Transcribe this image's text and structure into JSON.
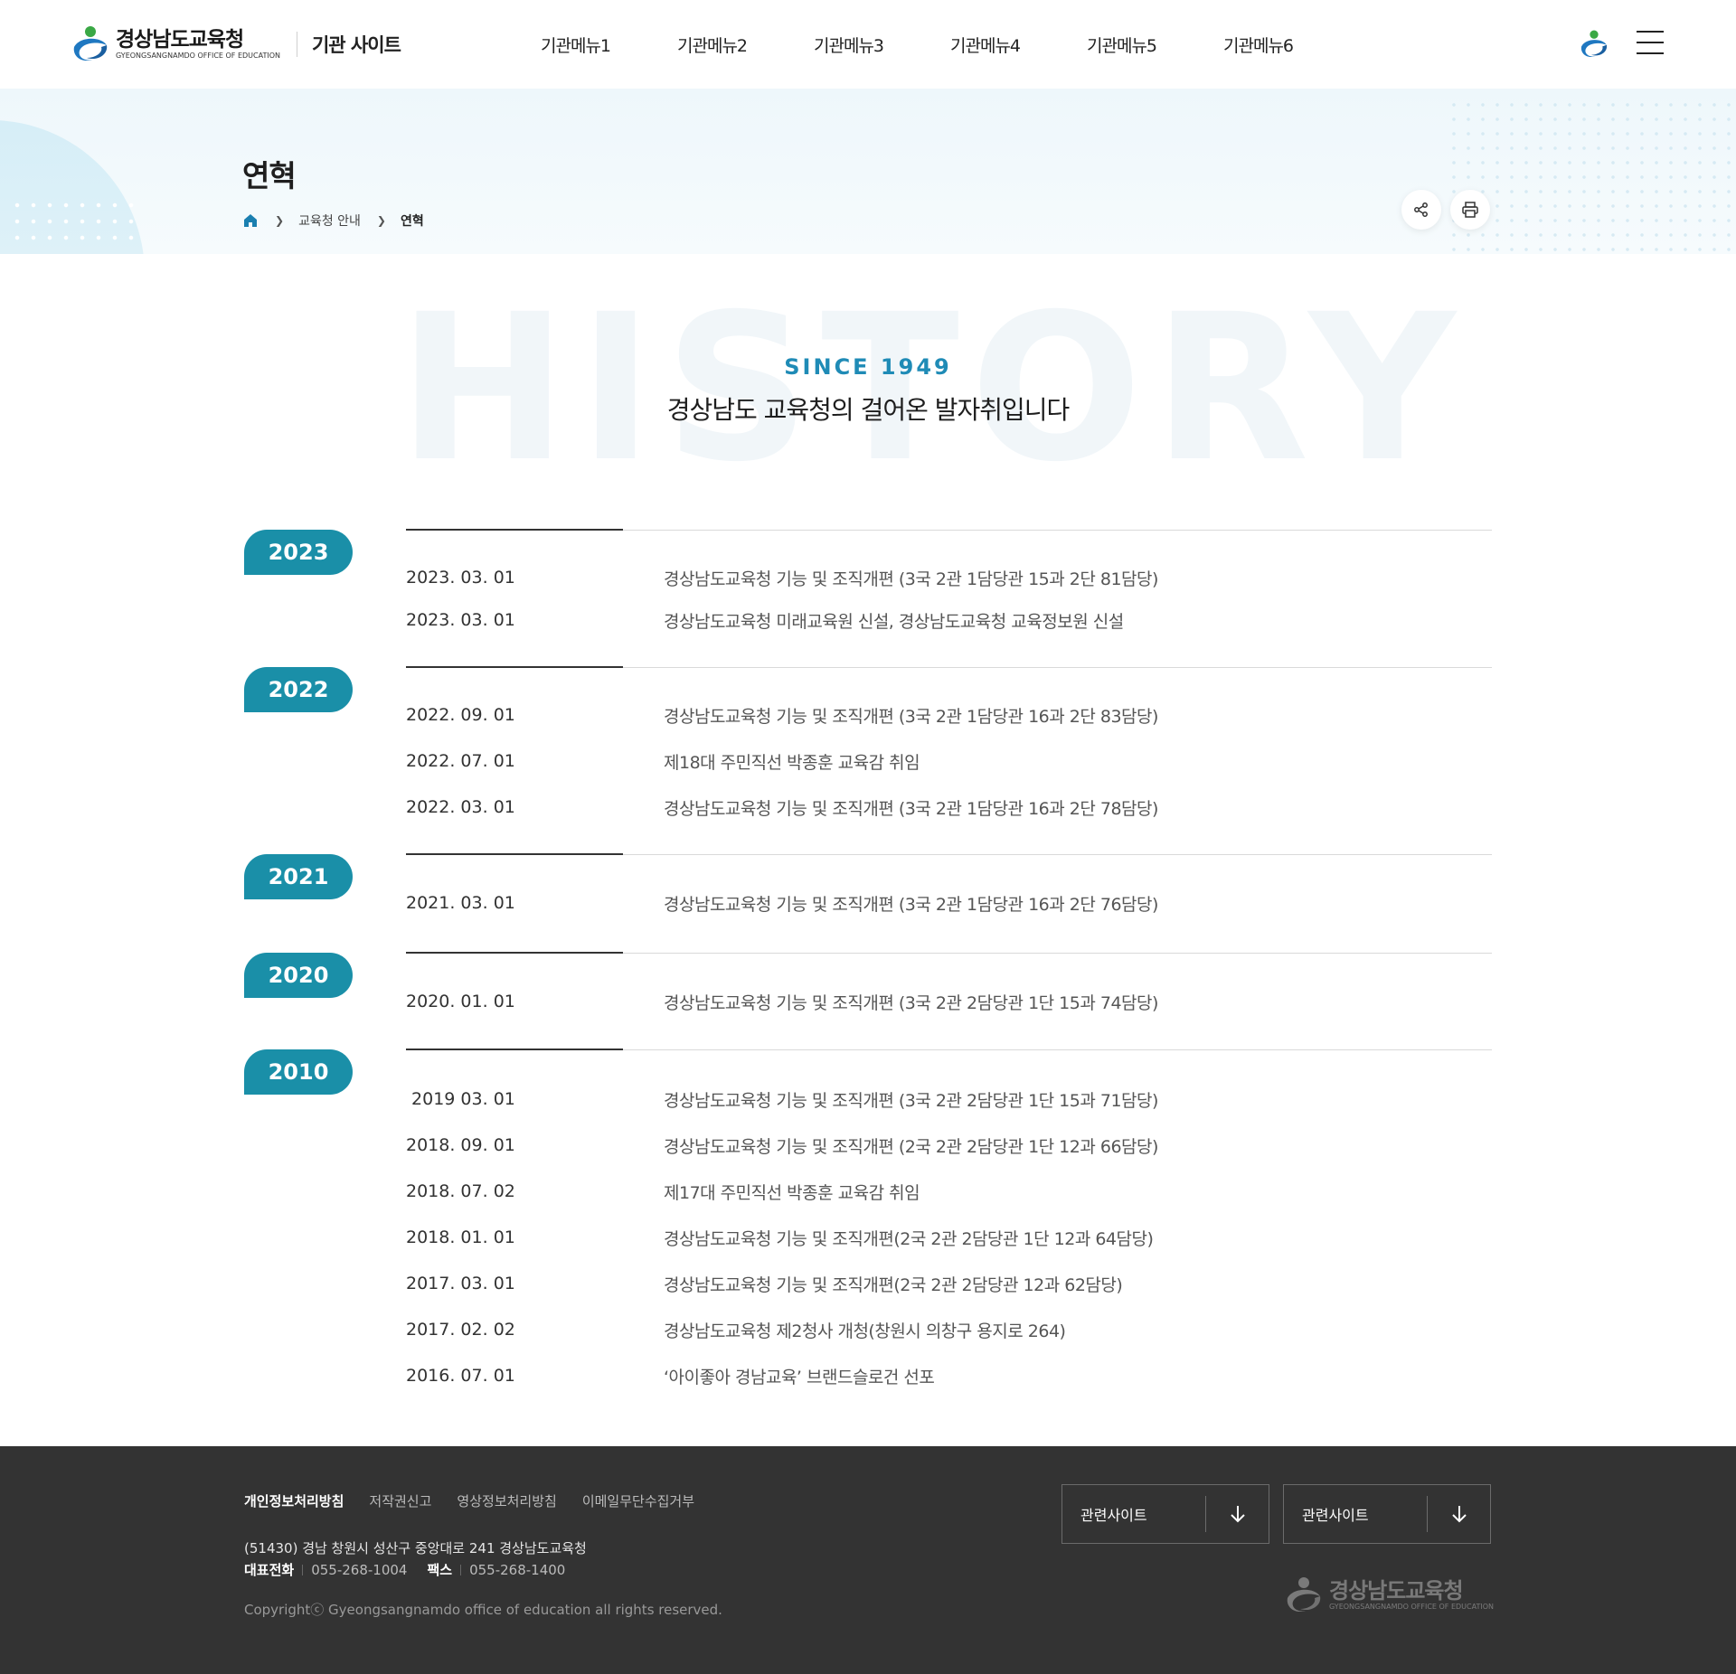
{
  "header": {
    "logo_name": "경상남도교육청",
    "logo_sub": "GYEONGSANGNAMDO OFFICE OF EDUCATION",
    "site_name": "기관 사이트",
    "menu": [
      "기관메뉴1",
      "기관메뉴2",
      "기관메뉴3",
      "기관메뉴4",
      "기관메뉴5",
      "기관메뉴6"
    ]
  },
  "subvisual": {
    "title": "연혁",
    "breadcrumb": [
      "교육청 안내",
      "연혁"
    ]
  },
  "intro": {
    "bg_word": "HISTORY",
    "since": "SINCE 1949",
    "title": "경상남도 교육청의 걸어온 발자취입니다"
  },
  "timeline": [
    {
      "year": "2023",
      "events": [
        {
          "date": "2023. 03. 01",
          "desc": "경상남도교육청 기능 및 조직개편 (3국 2관 1담당관 15과 2단 81담당)"
        },
        {
          "date": "2023. 03. 01",
          "desc": "경상남도교육청 미래교육원 신설, 경상남도교육청 교육정보원 신설"
        }
      ]
    },
    {
      "year": "2022",
      "events": [
        {
          "date": "2022. 09. 01",
          "desc": "경상남도교육청 기능 및 조직개편 (3국 2관 1담당관 16과 2단 83담당)"
        },
        {
          "date": "2022. 07. 01",
          "desc": "제18대 주민직선 박종훈 교육감 취임"
        },
        {
          "date": "2022. 03. 01",
          "desc": "경상남도교육청 기능 및 조직개편 (3국 2관 1담당관 16과 2단 78담당)"
        }
      ]
    },
    {
      "year": "2021",
      "events": [
        {
          "date": "2021. 03. 01",
          "desc": "경상남도교육청 기능 및 조직개편 (3국 2관 1담당관 16과 2단 76담당)"
        }
      ]
    },
    {
      "year": "2020",
      "events": [
        {
          "date": "2020. 01. 01",
          "desc": "경상남도교육청 기능 및 조직개편 (3국 2관 2담당관 1단 15과 74담당)"
        }
      ]
    },
    {
      "year": "2010",
      "events": [
        {
          "date": " 2019 03. 01",
          "desc": "경상남도교육청 기능 및 조직개편 (3국 2관 2담당관 1단 15과 71담당)"
        },
        {
          "date": "2018. 09. 01",
          "desc": "경상남도교육청 기능 및 조직개편 (2국 2관 2담당관 1단 12과 66담당)"
        },
        {
          "date": "2018. 07. 02",
          "desc": "제17대 주민직선 박종훈 교육감 취임"
        },
        {
          "date": "2018. 01. 01",
          "desc": "경상남도교육청 기능 및 조직개편(2국 2관 2담당관 1단 12과 64담당)"
        },
        {
          "date": "2017. 03. 01",
          "desc": "경상남도교육청 기능 및 조직개편(2국 2관 2담당관 12과 62담당)"
        },
        {
          "date": "2017. 02. 02",
          "desc": "경상남도교육청 제2청사 개청(창원시 의창구 용지로 264)"
        },
        {
          "date": "2016. 07. 01",
          "desc": "‘아이좋아 경남교육’ 브랜드슬로건 선포"
        }
      ]
    }
  ],
  "footer": {
    "links": [
      "개인정보처리방침",
      "저작권신고",
      "영상정보처리방침",
      "이메일무단수집거부"
    ],
    "address": "(51430) 경남 창원시 성산구 중앙대로 241 경상남도교육청",
    "tel_label": "대표전화",
    "tel": "055-268-1004",
    "fax_label": "팩스",
    "fax": "055-268-1400",
    "copyright": "Copyrightⓒ Gyeongsangnamdo office of education all rights reserved.",
    "selects": [
      "관련사이트",
      "관련사이트"
    ],
    "logo_name": "경상남도교육청",
    "logo_sub": "GYEONGSANGNAMDO OFFICE OF EDUCATION"
  },
  "colors": {
    "accent": "#1a8fa8",
    "since": "#1f8bb6",
    "footer_bg": "#333333"
  }
}
